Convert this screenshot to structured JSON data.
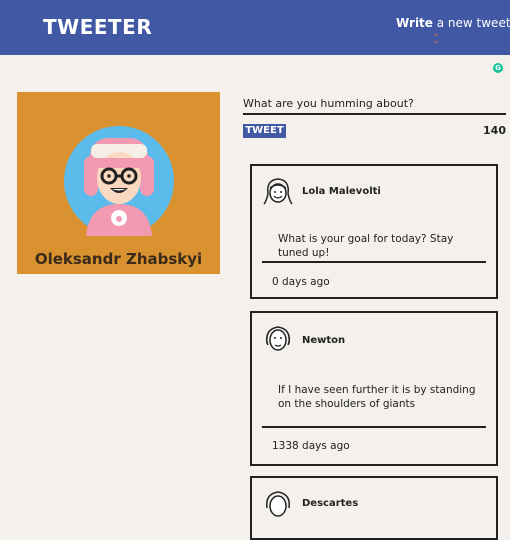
{
  "header": {
    "logo": "TWEETER",
    "write_bold": "Write",
    "write_rest": " a new tweet"
  },
  "profile": {
    "name": "Oleksandr Zhabskyi"
  },
  "composer": {
    "placeholder": "What are you humming about?",
    "button_label": "TWEET",
    "char_count": "140"
  },
  "tweets": [
    {
      "author": "Lola Malevolti",
      "text": "What is your goal for today? Stay tuned up!",
      "time": "0 days ago"
    },
    {
      "author": "Newton",
      "text": "If I have seen further it is by standing on the shoulders of giants",
      "time": "1338 days ago"
    },
    {
      "author": "Descartes",
      "text": "",
      "time": ""
    }
  ],
  "colors": {
    "header_bg": "#4158a4",
    "page_bg": "#f4f1ec",
    "profile_bg": "#d9922f",
    "accent_orange": "#e8743b"
  }
}
